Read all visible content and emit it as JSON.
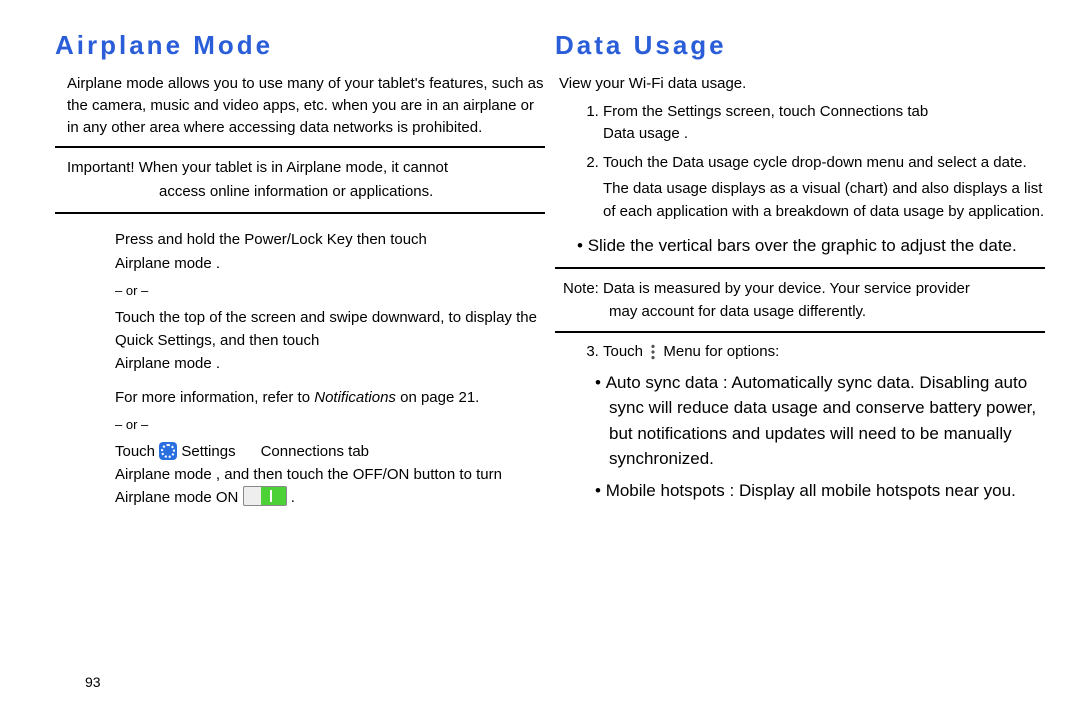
{
  "left": {
    "title": "Airplane Mode",
    "intro": "Airplane mode allows you to use many of your tablet's features, such as the camera, music and video apps, etc. when you are in an airplane or in any other area where accessing data networks is prohibited.",
    "important_label": "Important! ",
    "important_l1": "When your tablet is in Airplane mode, it cannot",
    "important_l2": "access online information or applications.",
    "block1_a": "Press and hold the ",
    "block1_b": "Power/Lock Key",
    "block1_c": " then touch ",
    "block1_d": "Airplane mode",
    "block1_e": ".",
    "or": "– or –",
    "block2": "Touch the top of the screen and swipe downward, to display the Quick Settings, and then touch ",
    "block2_b": "Airplane mode",
    "block2_c": ".",
    "block3_a": "For more information, refer to ",
    "block3_b": "Notifications",
    "block3_c": " on page 21.",
    "block4_a": "Touch ",
    "block4_settings": "Settings",
    "block4_arrow": " ",
    "block4_conn": "Connections",
    "block4_tab": " tab ",
    "block4_am": "Airplane mode",
    "block4_mid": ", and then touch the ",
    "block4_offon": "OFF/ON",
    "block4_end1": " button to turn Airplane mode ON ",
    "block4_end2": "."
  },
  "right": {
    "title": "Data Usage",
    "intro": "View your Wi-Fi data usage.",
    "step1_a": "From the ",
    "step1_b": "Settings",
    "step1_c": " screen, touch ",
    "step1_d": "Connections",
    "step1_e": " tab ",
    "step1_f": "Data usage",
    "step1_g": ".",
    "step2_a": "Touch the ",
    "step2_b": "Data usage cycle",
    "step2_c": " drop-down menu and select a date.",
    "step2_sub": "The data usage displays as a visual (chart) and also displays a list of each application with a breakdown of data usage by application.",
    "bullet_big": "Slide the vertical bars over the graphic to adjust the date.",
    "note_label": "Note: ",
    "note_l1": "Data is measured by your device. Your service provider",
    "note_l2": "may account for data usage differently.",
    "step3_a": "Touch ",
    "step3_b": "Menu",
    "step3_c": " for options:",
    "sb1_a": "Auto sync data",
    "sb1_b": ": Automatically sync data. Disabling auto sync will reduce data usage and conserve battery power, but notifications and updates will need to be manually synchronized.",
    "sb2_a": "Mobile hotspots",
    "sb2_b": ": Display all mobile hotspots near you."
  },
  "page_number": "93"
}
